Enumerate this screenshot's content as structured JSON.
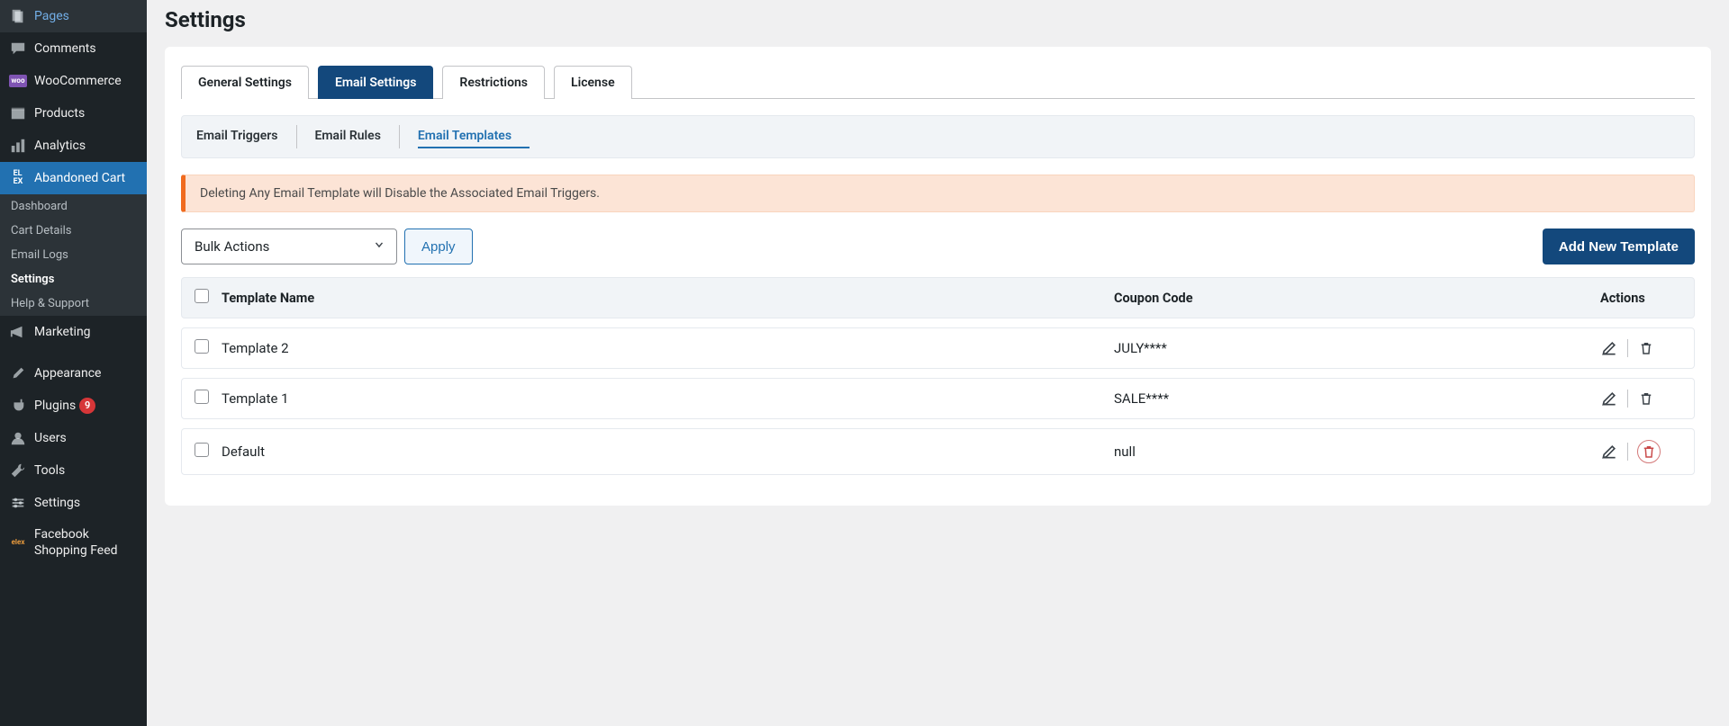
{
  "sidebar": {
    "items": [
      {
        "label": "Pages"
      },
      {
        "label": "Comments"
      },
      {
        "label": "WooCommerce"
      },
      {
        "label": "Products"
      },
      {
        "label": "Analytics"
      },
      {
        "label": "Abandoned Cart"
      },
      {
        "label": "Marketing"
      },
      {
        "label": "Appearance"
      },
      {
        "label": "Plugins",
        "badge": "9"
      },
      {
        "label": "Users"
      },
      {
        "label": "Tools"
      },
      {
        "label": "Settings"
      },
      {
        "label": "Facebook Shopping Feed"
      }
    ],
    "sub": [
      {
        "label": "Dashboard"
      },
      {
        "label": "Cart Details"
      },
      {
        "label": "Email Logs"
      },
      {
        "label": "Settings"
      },
      {
        "label": "Help & Support"
      }
    ]
  },
  "page": {
    "title": "Settings",
    "tabs": [
      {
        "label": "General Settings"
      },
      {
        "label": "Email Settings"
      },
      {
        "label": "Restrictions"
      },
      {
        "label": "License"
      }
    ],
    "subtabs": [
      {
        "label": "Email Triggers"
      },
      {
        "label": "Email Rules"
      },
      {
        "label": "Email Templates"
      }
    ],
    "warning": "Deleting Any Email Template will Disable the Associated Email Triggers.",
    "bulk_select": "Bulk Actions",
    "apply_label": "Apply",
    "add_label": "Add New Template",
    "headers": {
      "name": "Template Name",
      "coupon": "Coupon Code",
      "actions": "Actions"
    },
    "rows": [
      {
        "name": "Template 2",
        "coupon": "JULY****",
        "del_highlight": false
      },
      {
        "name": "Template 1",
        "coupon": "SALE****",
        "del_highlight": false
      },
      {
        "name": "Default",
        "coupon": "null",
        "del_highlight": true
      }
    ]
  }
}
